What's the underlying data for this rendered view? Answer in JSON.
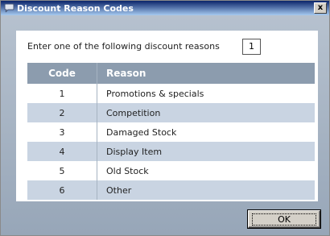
{
  "window": {
    "title": "Discount Reason Codes",
    "close_glyph": "x"
  },
  "prompt": {
    "text": "Enter one of the following discount reasons",
    "input_value": "1"
  },
  "table": {
    "headers": [
      "Code",
      "Reason"
    ],
    "rows": [
      {
        "code": "1",
        "reason": "Promotions & specials"
      },
      {
        "code": "2",
        "reason": "Competition"
      },
      {
        "code": "3",
        "reason": "Damaged Stock"
      },
      {
        "code": "4",
        "reason": "Display Item"
      },
      {
        "code": "5",
        "reason": "Old Stock"
      },
      {
        "code": "6",
        "reason": "Other"
      }
    ]
  },
  "buttons": {
    "ok_label": "OK"
  },
  "colors": {
    "header_bg": "#8c9cae",
    "alt_row_bg": "#c9d4e2",
    "titlebar_start": "#0a246a"
  },
  "icons": {
    "app": "chat-bubble-icon",
    "close": "close-icon"
  }
}
